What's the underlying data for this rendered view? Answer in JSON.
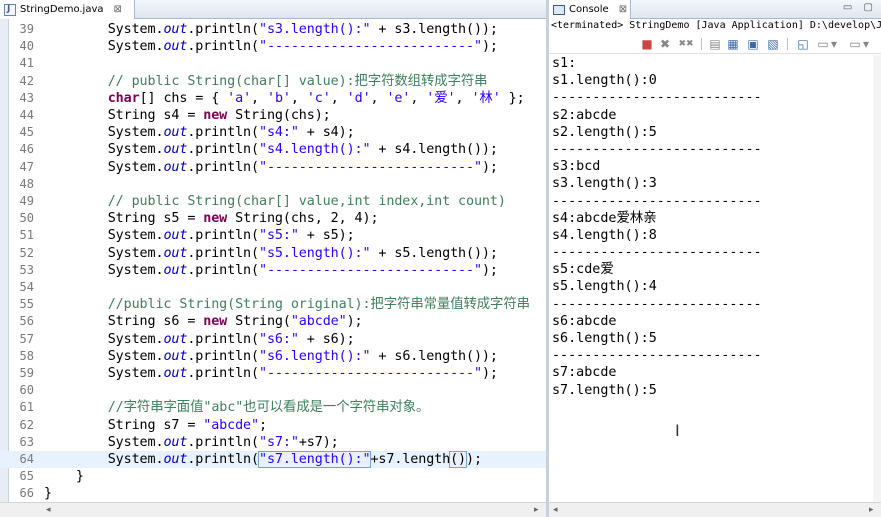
{
  "editor": {
    "tab_title": "StringDemo.java",
    "close_glyph": "⊠",
    "lines": [
      {
        "n": "39",
        "html": "        System.<span class=\"fld\">out</span>.println(<span class=\"str\">\"s3.length():\"</span> + s3.length());"
      },
      {
        "n": "40",
        "html": "        System.<span class=\"fld\">out</span>.println(<span class=\"str\">\"--------------------------\"</span>);"
      },
      {
        "n": "41",
        "html": ""
      },
      {
        "n": "42",
        "html": "        <span class=\"cmt\">// public String(char[] value):把字符数组转成字符串</span>"
      },
      {
        "n": "43",
        "html": "        <span class=\"kw\">char</span>[] chs = { <span class=\"str\">'a'</span>, <span class=\"str\">'b'</span>, <span class=\"str\">'c'</span>, <span class=\"str\">'d'</span>, <span class=\"str\">'e'</span>, <span class=\"str\">'爱'</span>, <span class=\"str\">'林'</span> };"
      },
      {
        "n": "44",
        "html": "        String s4 = <span class=\"kw\">new</span> String(chs);"
      },
      {
        "n": "45",
        "html": "        System.<span class=\"fld\">out</span>.println(<span class=\"str\">\"s4:\"</span> + s4);"
      },
      {
        "n": "46",
        "html": "        System.<span class=\"fld\">out</span>.println(<span class=\"str\">\"s4.length():\"</span> + s4.length());"
      },
      {
        "n": "47",
        "html": "        System.<span class=\"fld\">out</span>.println(<span class=\"str\">\"--------------------------\"</span>);"
      },
      {
        "n": "48",
        "html": ""
      },
      {
        "n": "49",
        "html": "        <span class=\"cmt\">// public String(char[] value,int index,int count)</span>"
      },
      {
        "n": "50",
        "html": "        String s5 = <span class=\"kw\">new</span> String(chs, 2, 4);"
      },
      {
        "n": "51",
        "html": "        System.<span class=\"fld\">out</span>.println(<span class=\"str\">\"s5:\"</span> + s5);"
      },
      {
        "n": "52",
        "html": "        System.<span class=\"fld\">out</span>.println(<span class=\"str\">\"s5.length():\"</span> + s5.length());"
      },
      {
        "n": "53",
        "html": "        System.<span class=\"fld\">out</span>.println(<span class=\"str\">\"--------------------------\"</span>);"
      },
      {
        "n": "54",
        "html": ""
      },
      {
        "n": "55",
        "html": "        <span class=\"cmt\">//public String(String original):把字符串常量值转成字符串</span>"
      },
      {
        "n": "56",
        "html": "        String s6 = <span class=\"kw\">new</span> String(<span class=\"str\">\"abcde\"</span>);"
      },
      {
        "n": "57",
        "html": "        System.<span class=\"fld\">out</span>.println(<span class=\"str\">\"s6:\"</span> + s6);"
      },
      {
        "n": "58",
        "html": "        System.<span class=\"fld\">out</span>.println(<span class=\"str\">\"s6.length():\"</span> + s6.length());"
      },
      {
        "n": "59",
        "html": "        System.<span class=\"fld\">out</span>.println(<span class=\"str\">\"--------------------------\"</span>);"
      },
      {
        "n": "60",
        "html": ""
      },
      {
        "n": "61",
        "html": "        <span class=\"cmt\">//字符串字面值\"abc\"也可以看成是一个字符串对象。</span>"
      },
      {
        "n": "62",
        "html": "        String s7 = <span class=\"str\">\"abcde\"</span>;"
      },
      {
        "n": "63",
        "html": "        System.<span class=\"fld\">out</span>.println(<span class=\"str\">\"s7:\"</span>+s7);"
      },
      {
        "n": "64",
        "html": "        System.<span class=\"fld\">out</span>.println(<span class=\"str hl-box\">\"s7.length():\"</span>+s7.length<span class=\"hl-box\">()</span>);",
        "current": true
      },
      {
        "n": "65",
        "html": "    }"
      },
      {
        "n": "66",
        "html": "}"
      }
    ]
  },
  "console": {
    "tab_title": "Console",
    "close_glyph": "⊠",
    "window_buttons": "▭ ▢",
    "status": "<terminated> StringDemo [Java Application] D:\\develop\\Java\\jdk",
    "toolbar": {
      "terminate_glyph": "■",
      "remove_glyph": "✖",
      "remove_all_glyph": "✖✖",
      "clear_glyph": "▤",
      "scroll_lock_glyph": "▦",
      "pin_glyph": "▣",
      "display_glyph": "▧",
      "open_glyph": "◱",
      "new_glyph": "▭",
      "dropdown_glyph": "▾"
    },
    "output": [
      "s1:",
      "s1.length():0",
      "--------------------------",
      "s2:abcde",
      "s2.length():5",
      "--------------------------",
      "s3:bcd",
      "s3.length():3",
      "--------------------------",
      "s4:abcde爱林亲",
      "s4.length():8",
      "--------------------------",
      "s5:cde爱",
      "s5.length():4",
      "--------------------------",
      "s6:abcde",
      "s6.length():5",
      "--------------------------",
      "s7:abcde",
      "s7.length():5"
    ],
    "cursor_glyph": "I"
  },
  "scroll_glyphs": {
    "left": "◂",
    "right": "▸"
  }
}
